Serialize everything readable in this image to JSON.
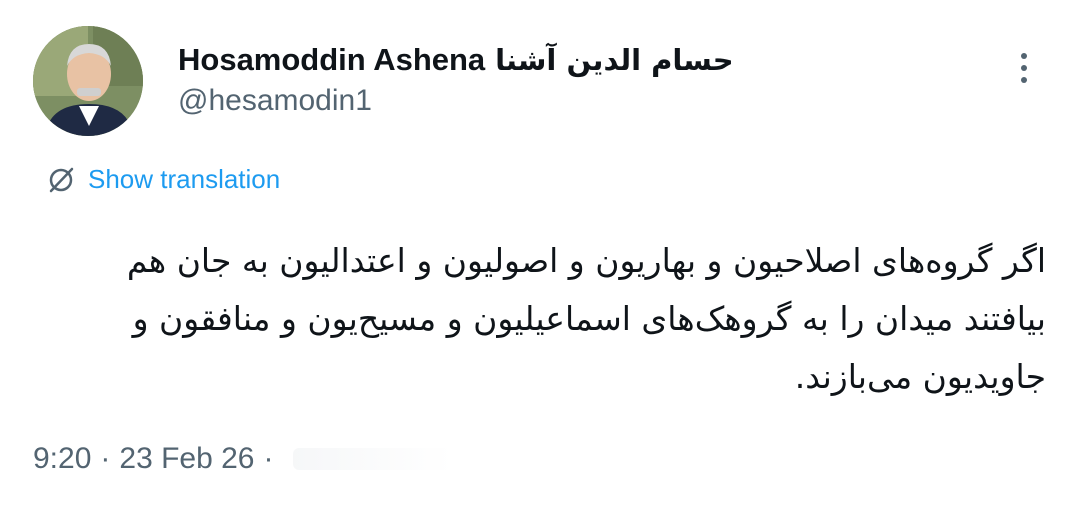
{
  "author": {
    "display_name": "Hosamoddin Ashena",
    "display_name_fa": "حسام الدین آشنا",
    "handle": "@hesamodin1",
    "avatar_icon": "profile-photo"
  },
  "actions": {
    "more_icon": "more-vertical-icon"
  },
  "translation": {
    "icon": "translate-icon",
    "label": "Show translation"
  },
  "tweet": {
    "text": "اگر گروه‌های اصلاحیون و بهاریون و اصولیون و اعتدالیون به جان هم\nبیافتند میدان را به گروهک‌های اسماعیلیون و مسیح‌یون و منافقون و\nجاویدیون می‌بازند."
  },
  "meta": {
    "time": "9:20",
    "separator": "·",
    "date": "23 Feb 26"
  },
  "colors": {
    "text": "#0f1419",
    "secondary": "#536471",
    "accent": "#1d9bf0",
    "background": "#ffffff"
  }
}
